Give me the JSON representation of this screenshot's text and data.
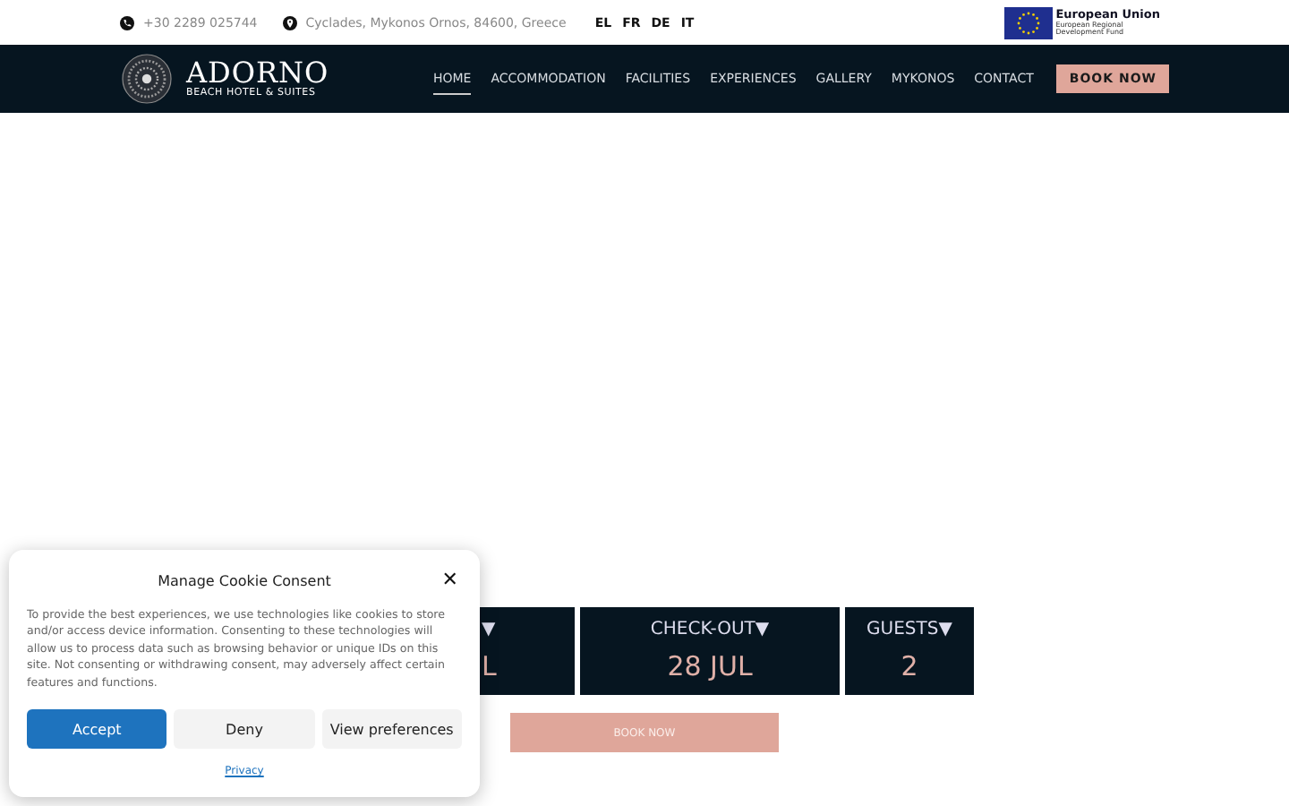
{
  "topbar": {
    "phone": "+30 2289 025744",
    "address": "Cyclades, Mykonos Ornos, 84600, Greece",
    "languages": [
      "EL",
      "FR",
      "DE",
      "IT"
    ],
    "eu_badge": {
      "title": "European Union",
      "subtitle": "European Regional Development Fund"
    }
  },
  "header": {
    "logo": {
      "name": "ADORNO",
      "tagline": "BEACH HOTEL & SUITES"
    },
    "nav": [
      {
        "label": "HOME",
        "selected": true
      },
      {
        "label": "ACCOMMODATION",
        "selected": false
      },
      {
        "label": "FACILITIES",
        "selected": false
      },
      {
        "label": "EXPERIENCES",
        "selected": false
      },
      {
        "label": "GALLERY",
        "selected": false
      },
      {
        "label": "MYKONOS",
        "selected": false
      },
      {
        "label": "CONTACT",
        "selected": false
      }
    ],
    "cta": "BOOK NOW"
  },
  "booking": {
    "fields": [
      {
        "label": "▼",
        "value": "L"
      },
      {
        "label": "CHECK-OUT▼",
        "value": "28 JUL"
      },
      {
        "label": "GUESTS▼",
        "value": "2"
      }
    ],
    "button": "BOOK NOW"
  },
  "cookie_dialog": {
    "title": "Manage Cookie Consent",
    "close": "✕",
    "text": "To provide the best experiences, we use technologies like cookies to store and/or access device information. Consenting to these technologies will allow us to process data such as browsing behavior or unique IDs on this site. Not consenting or withdrawing consent, may adversely affect certain features and functions.",
    "buttons": [
      {
        "label": "Accept",
        "kind": "primary"
      },
      {
        "label": "Deny",
        "kind": "secondary"
      },
      {
        "label": "View preferences",
        "kind": "secondary"
      }
    ],
    "link": "Privacy"
  }
}
